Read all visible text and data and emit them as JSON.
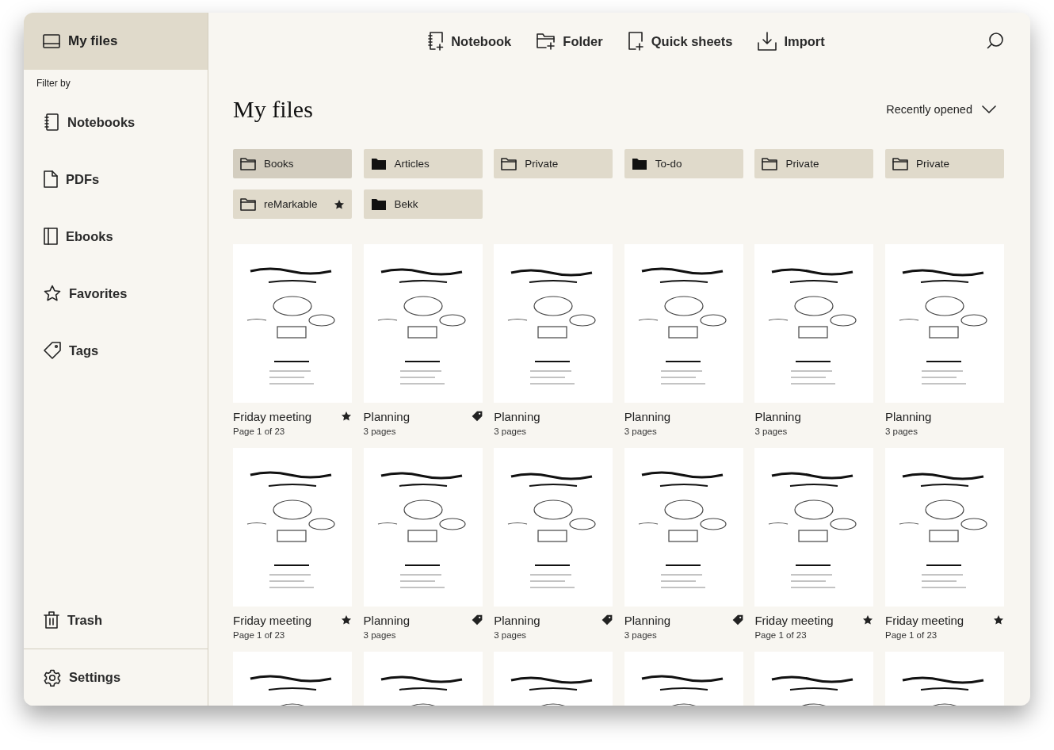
{
  "sidebar": {
    "home": {
      "label": "My files",
      "selected": true
    },
    "filter_label": "Filter by",
    "filters": [
      {
        "kind": "notebooks",
        "label": "Notebooks"
      },
      {
        "kind": "pdfs",
        "label": "PDFs"
      },
      {
        "kind": "ebooks",
        "label": "Ebooks"
      },
      {
        "kind": "favorites",
        "label": "Favorites"
      },
      {
        "kind": "tags",
        "label": "Tags"
      }
    ],
    "trash": {
      "label": "Trash"
    },
    "settings": {
      "label": "Settings"
    }
  },
  "toolbar": {
    "actions": [
      {
        "kind": "notebook",
        "label": "Notebook"
      },
      {
        "kind": "folder",
        "label": "Folder"
      },
      {
        "kind": "sheets",
        "label": "Quick sheets"
      },
      {
        "kind": "import",
        "label": "Import"
      }
    ]
  },
  "title": "My files",
  "sort": {
    "label": "Recently opened"
  },
  "folders": [
    {
      "name": "Books",
      "selected": true,
      "filled": false,
      "starred": false
    },
    {
      "name": "Articles",
      "selected": false,
      "filled": true,
      "starred": false
    },
    {
      "name": "Private",
      "selected": false,
      "filled": false,
      "starred": false
    },
    {
      "name": "To-do",
      "selected": false,
      "filled": true,
      "starred": false
    },
    {
      "name": "Private",
      "selected": false,
      "filled": false,
      "starred": false
    },
    {
      "name": "Private",
      "selected": false,
      "filled": false,
      "starred": false
    },
    {
      "name": "reMarkable",
      "selected": false,
      "filled": false,
      "starred": true
    },
    {
      "name": "Bekk",
      "selected": false,
      "filled": true,
      "starred": false
    }
  ],
  "files": [
    {
      "title": "Friday meeting",
      "subtitle": "Page 1 of 23",
      "starred": true,
      "tagged": false,
      "thumbnail": {
        "kind": "picture"
      }
    },
    {
      "title": "Planning",
      "subtitle": "3 pages",
      "starred": false,
      "tagged": true,
      "thumbnail": {
        "kind": "picture"
      }
    },
    {
      "title": "Planning",
      "subtitle": "3 pages",
      "starred": false,
      "tagged": false,
      "thumbnail": {
        "kind": "picture"
      }
    },
    {
      "title": "Planning",
      "subtitle": "3 pages",
      "starred": false,
      "tagged": false,
      "thumbnail": {
        "kind": "picture"
      }
    },
    {
      "title": "Planning",
      "subtitle": "3 pages",
      "starred": false,
      "tagged": false,
      "thumbnail": {
        "kind": "picture"
      }
    },
    {
      "title": "Planning",
      "subtitle": "3 pages",
      "starred": false,
      "tagged": false,
      "thumbnail": {
        "kind": "picture"
      }
    },
    {
      "title": "Friday meeting",
      "subtitle": "Page 1 of 23",
      "starred": true,
      "tagged": false,
      "thumbnail": {
        "kind": "picture"
      }
    },
    {
      "title": "Planning",
      "subtitle": "3 pages",
      "starred": false,
      "tagged": true,
      "thumbnail": {
        "kind": "picture"
      }
    },
    {
      "title": "Planning",
      "subtitle": "3 pages",
      "starred": false,
      "tagged": true,
      "thumbnail": {
        "kind": "picture"
      }
    },
    {
      "title": "Planning",
      "subtitle": "3 pages",
      "starred": false,
      "tagged": true,
      "thumbnail": {
        "kind": "picture"
      }
    },
    {
      "title": "Friday meeting",
      "subtitle": "Page 1 of 23",
      "starred": true,
      "tagged": false,
      "thumbnail": {
        "kind": "picture"
      }
    },
    {
      "title": "Friday meeting",
      "subtitle": "Page 1 of 23",
      "starred": true,
      "tagged": false,
      "thumbnail": {
        "kind": "picture"
      }
    },
    {
      "thumbnail": {
        "kind": "picture"
      }
    },
    {
      "thumbnail": {
        "kind": "picture"
      }
    },
    {
      "thumbnail": {
        "kind": "picture"
      }
    },
    {
      "thumbnail": {
        "kind": "picture"
      }
    },
    {
      "thumbnail": {
        "kind": "picture"
      }
    },
    {
      "thumbnail": {
        "kind": "picture"
      }
    }
  ]
}
